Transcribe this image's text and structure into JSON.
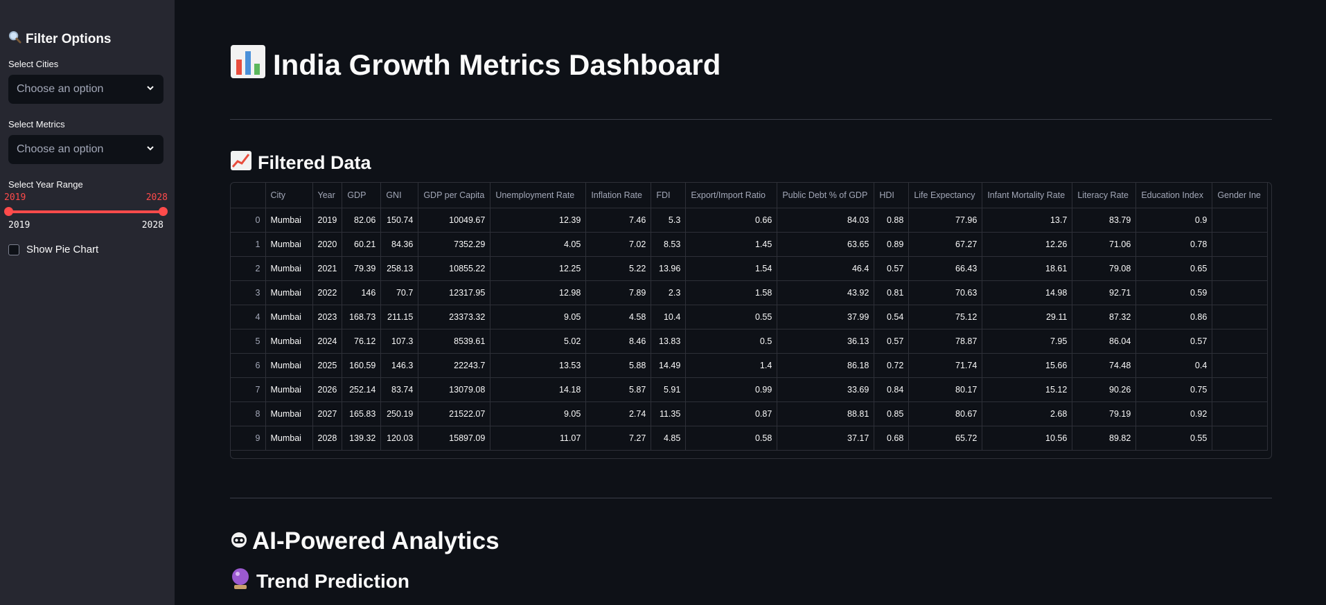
{
  "sidebar": {
    "title": "Filter Options",
    "title_icon": "magnifier-icon",
    "cities_label": "Select Cities",
    "cities_placeholder": "Choose an option",
    "metrics_label": "Select Metrics",
    "metrics_placeholder": "Choose an option",
    "year_label": "Select Year Range",
    "year_min_value": "2019",
    "year_max_value": "2028",
    "year_min_tick": "2019",
    "year_max_tick": "2028",
    "pie_label": "Show Pie Chart"
  },
  "main": {
    "title": "India Growth Metrics Dashboard",
    "title_icon": "bar-chart-icon",
    "filtered_heading": "Filtered Data",
    "filtered_icon": "chart-increasing-icon",
    "ai_heading": "AI-Powered Analytics",
    "ai_icon": "robot-icon",
    "trend_heading": "Trend Prediction",
    "trend_icon": "crystal-ball-icon"
  },
  "table": {
    "columns": [
      "",
      "City",
      "Year",
      "GDP",
      "GNI",
      "GDP per Capita",
      "Unemployment Rate",
      "Inflation Rate",
      "FDI",
      "Export/Import Ratio",
      "Public Debt % of GDP",
      "HDI",
      "Life Expectancy",
      "Infant Mortality Rate",
      "Literacy Rate",
      "Education Index",
      "Gender Ine"
    ],
    "rows": [
      [
        "0",
        "Mumbai",
        "2019",
        "82.06",
        "150.74",
        "10049.67",
        "12.39",
        "7.46",
        "5.3",
        "0.66",
        "84.03",
        "0.88",
        "77.96",
        "13.7",
        "83.79",
        "0.9",
        ""
      ],
      [
        "1",
        "Mumbai",
        "2020",
        "60.21",
        "84.36",
        "7352.29",
        "4.05",
        "7.02",
        "8.53",
        "1.45",
        "63.65",
        "0.89",
        "67.27",
        "12.26",
        "71.06",
        "0.78",
        ""
      ],
      [
        "2",
        "Mumbai",
        "2021",
        "79.39",
        "258.13",
        "10855.22",
        "12.25",
        "5.22",
        "13.96",
        "1.54",
        "46.4",
        "0.57",
        "66.43",
        "18.61",
        "79.08",
        "0.65",
        ""
      ],
      [
        "3",
        "Mumbai",
        "2022",
        "146",
        "70.7",
        "12317.95",
        "12.98",
        "7.89",
        "2.3",
        "1.58",
        "43.92",
        "0.81",
        "70.63",
        "14.98",
        "92.71",
        "0.59",
        ""
      ],
      [
        "4",
        "Mumbai",
        "2023",
        "168.73",
        "211.15",
        "23373.32",
        "9.05",
        "4.58",
        "10.4",
        "0.55",
        "37.99",
        "0.54",
        "75.12",
        "29.11",
        "87.32",
        "0.86",
        ""
      ],
      [
        "5",
        "Mumbai",
        "2024",
        "76.12",
        "107.3",
        "8539.61",
        "5.02",
        "8.46",
        "13.83",
        "0.5",
        "36.13",
        "0.57",
        "78.87",
        "7.95",
        "86.04",
        "0.57",
        ""
      ],
      [
        "6",
        "Mumbai",
        "2025",
        "160.59",
        "146.3",
        "22243.7",
        "13.53",
        "5.88",
        "14.49",
        "1.4",
        "86.18",
        "0.72",
        "71.74",
        "15.66",
        "74.48",
        "0.4",
        ""
      ],
      [
        "7",
        "Mumbai",
        "2026",
        "252.14",
        "83.74",
        "13079.08",
        "14.18",
        "5.87",
        "5.91",
        "0.99",
        "33.69",
        "0.84",
        "80.17",
        "15.12",
        "90.26",
        "0.75",
        ""
      ],
      [
        "8",
        "Mumbai",
        "2027",
        "165.83",
        "250.19",
        "21522.07",
        "9.05",
        "2.74",
        "11.35",
        "0.87",
        "88.81",
        "0.85",
        "80.67",
        "2.68",
        "79.19",
        "0.92",
        ""
      ],
      [
        "9",
        "Mumbai",
        "2028",
        "139.32",
        "120.03",
        "15897.09",
        "11.07",
        "7.27",
        "4.85",
        "0.58",
        "37.17",
        "0.68",
        "65.72",
        "10.56",
        "89.82",
        "0.55",
        ""
      ]
    ]
  },
  "colors": {
    "accent": "#ff4b4b",
    "sidebar_bg": "#262730",
    "main_bg": "#0e1117"
  }
}
